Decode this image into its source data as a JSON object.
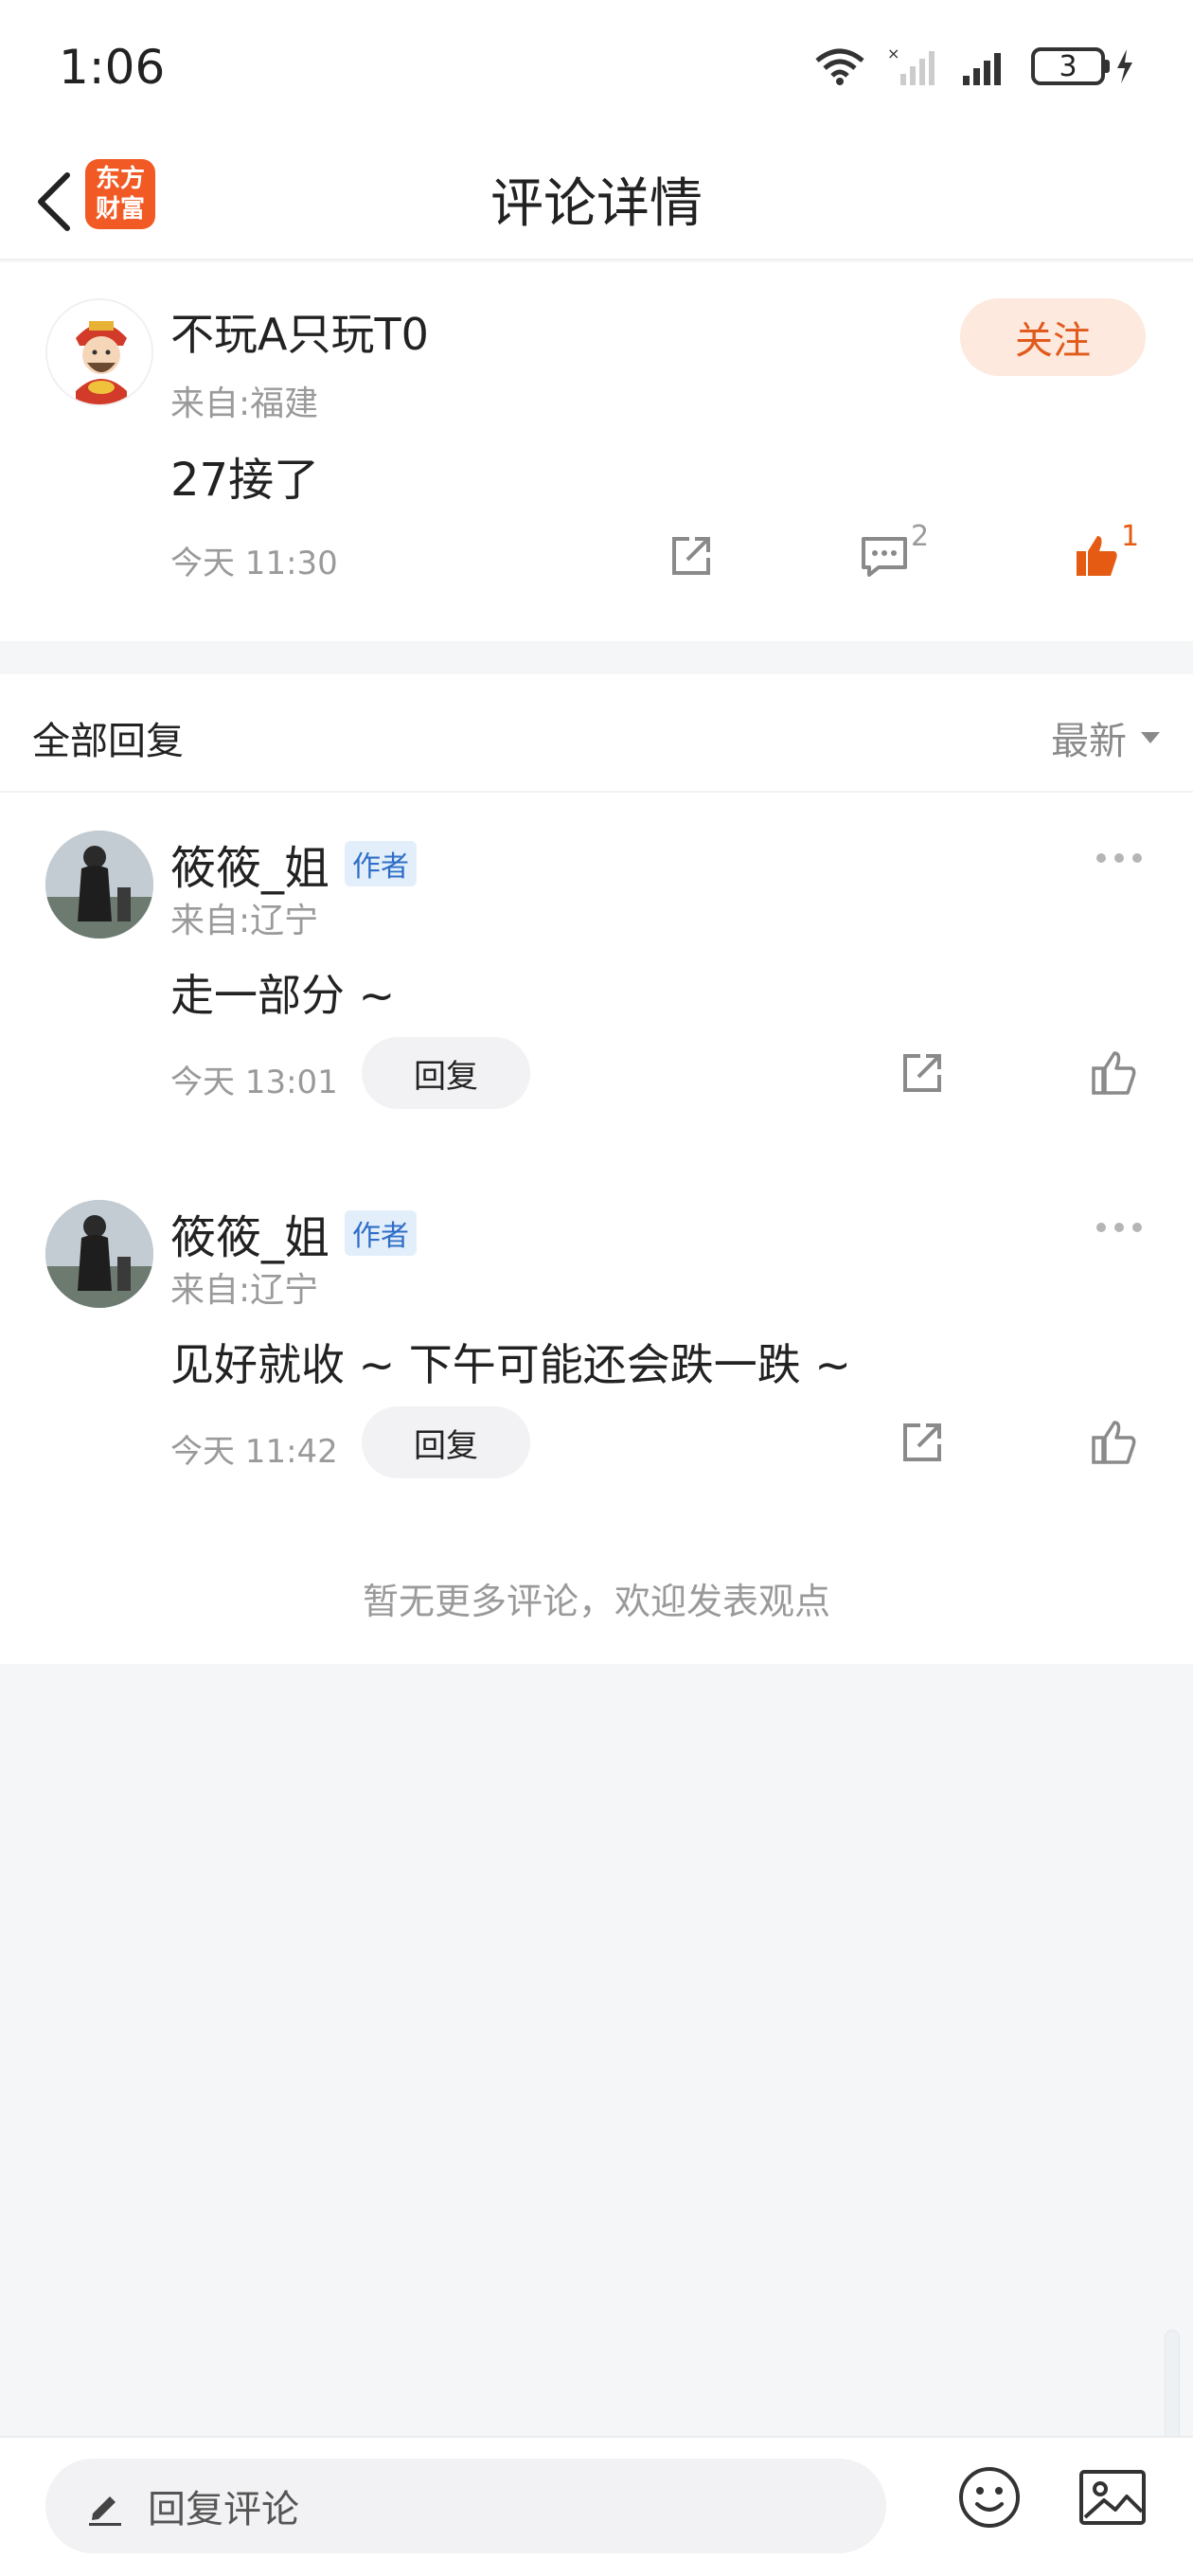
{
  "status_bar": {
    "time": "1:06",
    "battery": "3"
  },
  "header": {
    "title": "评论详情",
    "app_logo": "东方财富"
  },
  "main_comment": {
    "username": "不玩A只玩T0",
    "location": "来自:福建",
    "text": "27接了",
    "time": "今天 11:30",
    "follow_label": "关注",
    "reply_count": "2",
    "like_count": "1"
  },
  "replies_section": {
    "title": "全部回复",
    "sort_label": "最新"
  },
  "replies": [
    {
      "username": "筱筱_姐",
      "tag": "作者",
      "location": "来自:辽宁",
      "text": "走一部分 ~",
      "time": "今天 13:01",
      "reply_label": "回复"
    },
    {
      "username": "筱筱_姐",
      "tag": "作者",
      "location": "来自:辽宁",
      "text": "见好就收 ~ 下午可能还会跌一跌 ~",
      "time": "今天 11:42",
      "reply_label": "回复"
    }
  ],
  "footer_note": "暂无更多评论，欢迎发表观点",
  "bottom_bar": {
    "reply_placeholder": "回复评论"
  },
  "colors": {
    "accent": "#e15a1c",
    "like_active": "#e55b13",
    "author_tag": "#2f6fc7"
  },
  "icons": [
    "back-arrow-icon",
    "share-icon",
    "comment-icon",
    "thumbs-up-icon",
    "more-dots-icon",
    "dropdown-triangle-icon",
    "pencil-icon",
    "emoji-icon",
    "image-icon"
  ]
}
